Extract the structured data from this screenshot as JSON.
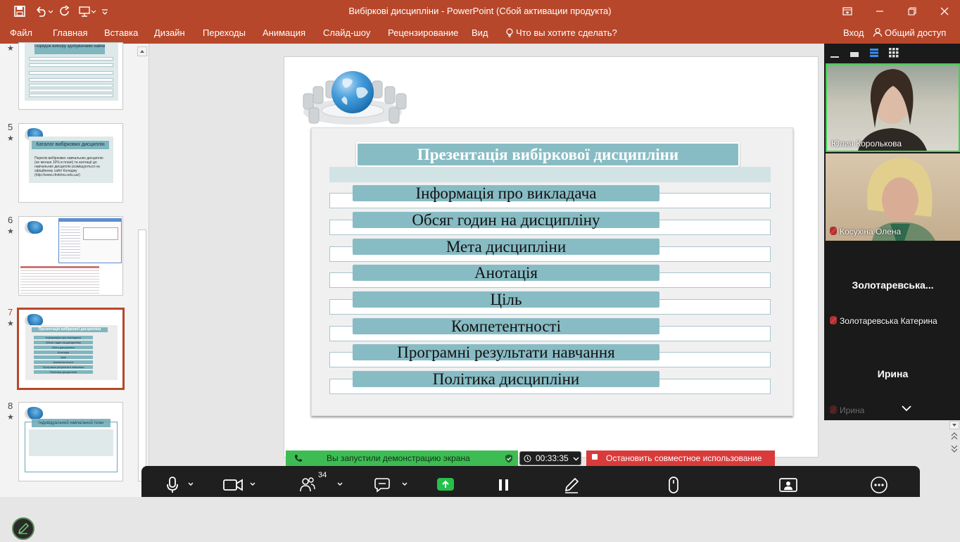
{
  "window": {
    "title": "Вибіркові дисципліни - PowerPoint (Сбой активации продукта)"
  },
  "ribbon": {
    "tabs": [
      "Файл",
      "Главная",
      "Вставка",
      "Дизайн",
      "Переходы",
      "Анимация",
      "Слайд-шоу",
      "Рецензирование",
      "Вид"
    ],
    "tell_me": "Что вы хотите сделать?",
    "signin": "Вход",
    "share": "Общий доступ"
  },
  "thumbnails": {
    "slide4": {
      "title": "Порядок вибору здобувачами навчальних дисциплін"
    },
    "slide5": {
      "number": "5",
      "title": "Каталог вибіркових дисциплін",
      "text": "Перелік вибіркових навчальних дисциплін (не менше 10% в плані) та анотації до навчальних дисциплін розміщуються на офіційному сайті Коледжу (http://www.cfmkhnu.edu.ua/)"
    },
    "slide6": {
      "number": "6"
    },
    "slide7": {
      "number": "7",
      "title": "Презентація вибіркової дисципліни"
    },
    "slide8": {
      "number": "8",
      "title": "Індивідуальний навчальний план"
    }
  },
  "slide": {
    "title": "Презентація вибіркової дисципліни",
    "items": [
      "Інформація про викладача",
      "Обсяг годин на дисципліну",
      "Мета дисципліни",
      "Анотація",
      "Ціль",
      "Компетентності",
      "Програмні результати навчання",
      "Політика дисципліни"
    ]
  },
  "screenshare": {
    "status": "Вы запустили демонстрацию экрана",
    "timer": "00:33:35",
    "stop_label": "Остановить совместное использование"
  },
  "zoom_toolbar": {
    "participants_count": "34"
  },
  "participants": [
    {
      "name": "Юлия Королькова"
    },
    {
      "name": "Косухіна Олена"
    },
    {
      "display": "Золотаревська...",
      "name": "Золотаревська Катерина"
    },
    {
      "display": "Ирина",
      "name": "Ирина"
    }
  ],
  "colors": {
    "powerpoint_red": "#b7472a",
    "slide_accent": "#88bcc4",
    "share_green": "#3dbc54",
    "stop_red": "#d93b3b"
  }
}
